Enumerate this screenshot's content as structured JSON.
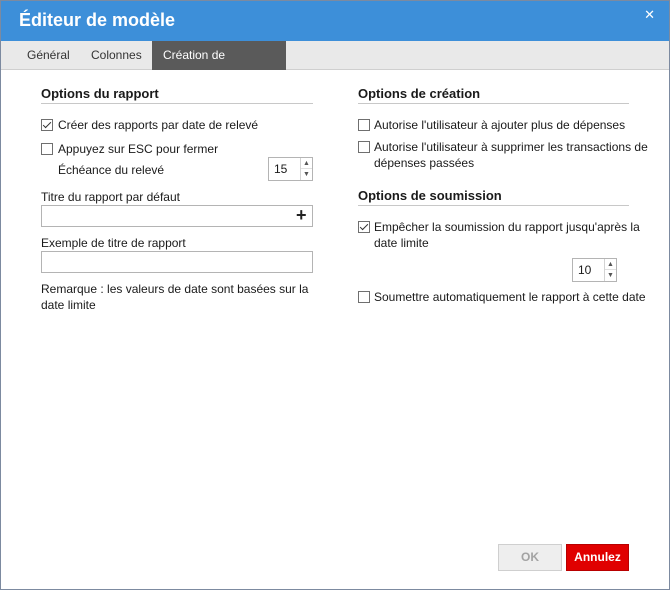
{
  "window": {
    "title": "Éditeur de modèle",
    "close_glyph": "✕"
  },
  "tabs": [
    {
      "label": "Général",
      "active": false
    },
    {
      "label": "Colonnes",
      "active": false
    },
    {
      "label": "Création de dépenses",
      "active": true
    }
  ],
  "report_options": {
    "heading": "Options du rapport",
    "create_by_date": {
      "label": "Créer des rapports par date de relevé",
      "checked": true
    },
    "esc_close": {
      "label": "Appuyez sur ESC pour fermer",
      "checked": false
    },
    "statement_due": {
      "label": "Échéance du relevé",
      "value": "15"
    },
    "default_title": {
      "label": "Titre du rapport par défaut",
      "value": "",
      "add_glyph": "+"
    },
    "example_title": {
      "label": "Exemple de titre de rapport",
      "value": ""
    },
    "note": "Remarque : les valeurs de date sont basées sur la date limite"
  },
  "creation_options": {
    "heading": "Options de création",
    "allow_more": {
      "label": "Autorise l'utilisateur à ajouter plus de dépenses",
      "checked": false
    },
    "allow_delete": {
      "label": "Autorise l'utilisateur à supprimer les transactions de dépenses passées",
      "checked": false
    }
  },
  "submission_options": {
    "heading": "Options de soumission",
    "prevent_submit": {
      "label": "Empêcher la soumission du rapport jusqu'après la date limite",
      "checked": true
    },
    "days": {
      "value": "10"
    },
    "auto_submit": {
      "label": "Soumettre automatiquement le rapport à cette date",
      "checked": false
    }
  },
  "footer": {
    "ok_label": "OK",
    "cancel_label": "Annulez"
  },
  "colors": {
    "titlebar": "#3d8fd9",
    "active_tab": "#5a5a5a",
    "cancel": "#e00000"
  }
}
